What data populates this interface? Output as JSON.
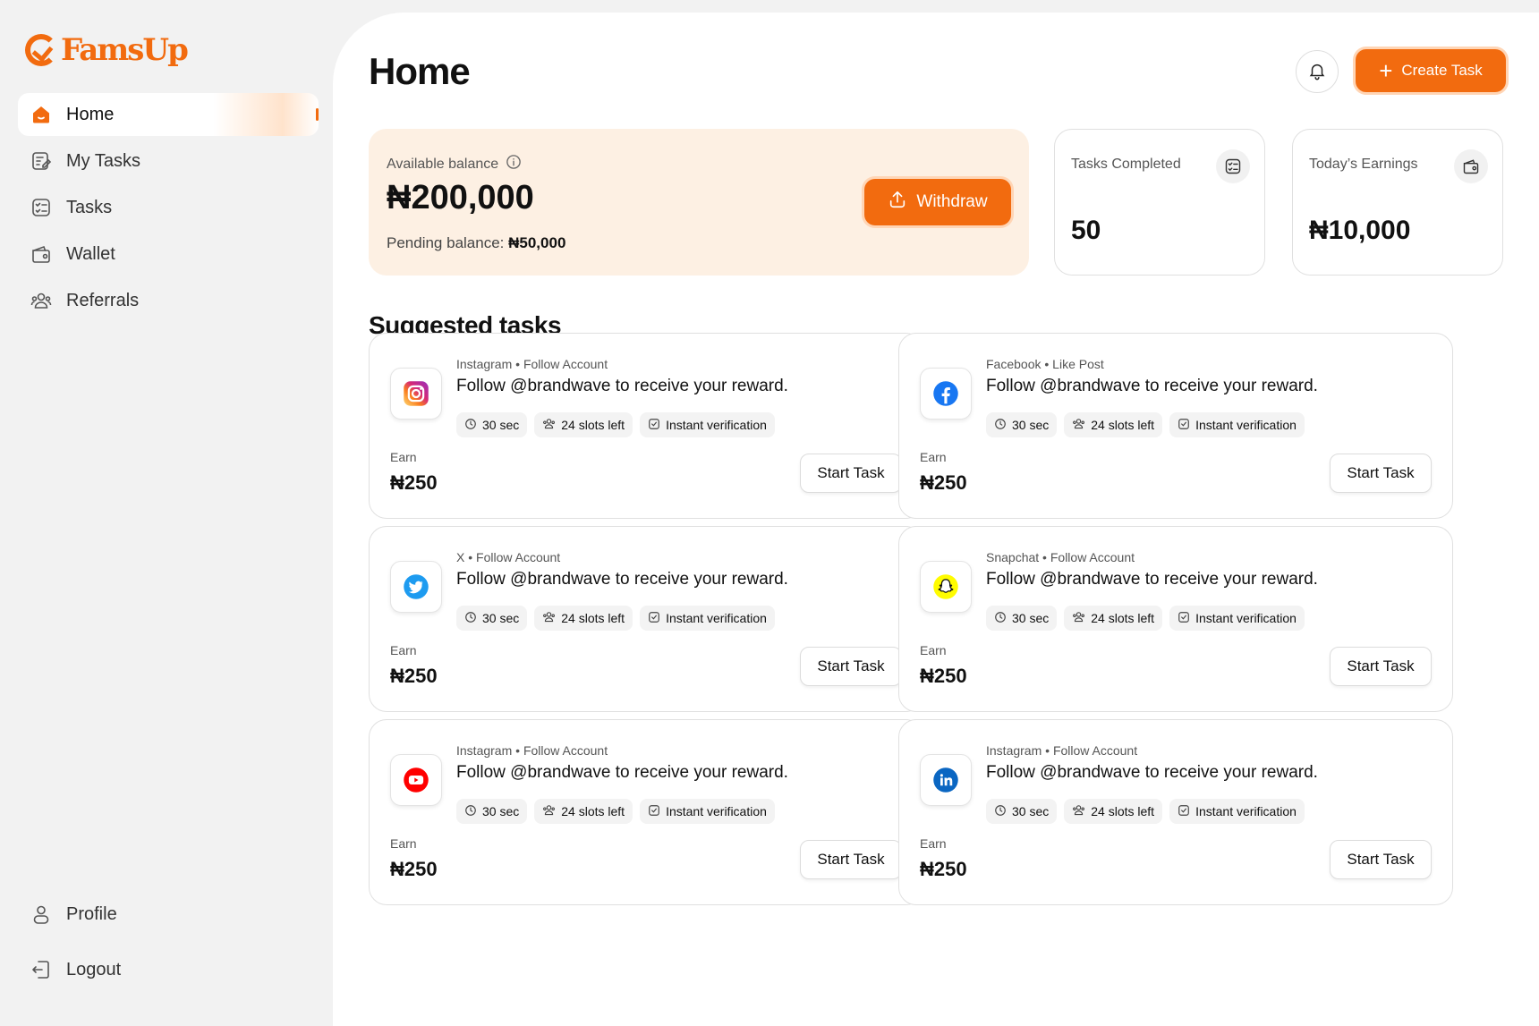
{
  "app": {
    "logo_text": "FamsUp"
  },
  "sidebar": {
    "items": [
      {
        "label": "Home"
      },
      {
        "label": "My Tasks"
      },
      {
        "label": "Tasks"
      },
      {
        "label": "Wallet"
      },
      {
        "label": "Referrals"
      }
    ],
    "bottom": [
      {
        "label": "Profile"
      },
      {
        "label": "Logout"
      }
    ]
  },
  "header": {
    "title": "Home",
    "create_label": "Create Task"
  },
  "balance": {
    "label": "Available balance",
    "amount": "₦200,000",
    "pending_label": "Pending balance:",
    "pending_amount": "₦50,000",
    "withdraw_label": "Withdraw"
  },
  "stats": [
    {
      "label": "Tasks Completed",
      "value": "50"
    },
    {
      "label": "Today’s Earnings",
      "value": "₦10,000"
    }
  ],
  "section": {
    "title": "Suggested tasks"
  },
  "tasks": [
    {
      "platform": "Instagram",
      "action": "Follow Account",
      "title": "Follow @brandwave to receive your reward.",
      "time": "30 sec",
      "slots": "24 slots left",
      "verify": "Instant verification",
      "earn_label": "Earn",
      "earn": "₦250",
      "button": "Start Task",
      "icon": "instagram-icon"
    },
    {
      "platform": "Facebook",
      "action": "Like Post",
      "title": "Follow @brandwave to receive your reward.",
      "time": "30 sec",
      "slots": "24 slots left",
      "verify": "Instant verification",
      "earn_label": "Earn",
      "earn": "₦250",
      "button": "Start Task",
      "icon": "facebook-icon"
    },
    {
      "platform": "X",
      "action": "Follow Account",
      "title": "Follow @brandwave to receive your reward.",
      "time": "30 sec",
      "slots": "24 slots left",
      "verify": "Instant verification",
      "earn_label": "Earn",
      "earn": "₦250",
      "button": "Start Task",
      "icon": "twitter-icon"
    },
    {
      "platform": "Snapchat",
      "action": "Follow Account",
      "title": "Follow @brandwave to receive your reward.",
      "time": "30 sec",
      "slots": "24 slots left",
      "verify": "Instant verification",
      "earn_label": "Earn",
      "earn": "₦250",
      "button": "Start Task",
      "icon": "snapchat-icon"
    },
    {
      "platform": "Instagram",
      "action": "Follow Account",
      "title": "Follow @brandwave to receive your reward.",
      "time": "30 sec",
      "slots": "24 slots left",
      "verify": "Instant verification",
      "earn_label": "Earn",
      "earn": "₦250",
      "button": "Start Task",
      "icon": "youtube-icon"
    },
    {
      "platform": "Instagram",
      "action": "Follow Account",
      "title": "Follow @brandwave to receive your reward.",
      "time": "30 sec",
      "slots": "24 slots left",
      "verify": "Instant verification",
      "earn_label": "Earn",
      "earn": "₦250",
      "button": "Start Task",
      "icon": "linkedin-icon"
    }
  ],
  "colors": {
    "accent": "#f26b0f",
    "balance_bg": "#fdf0e3"
  }
}
